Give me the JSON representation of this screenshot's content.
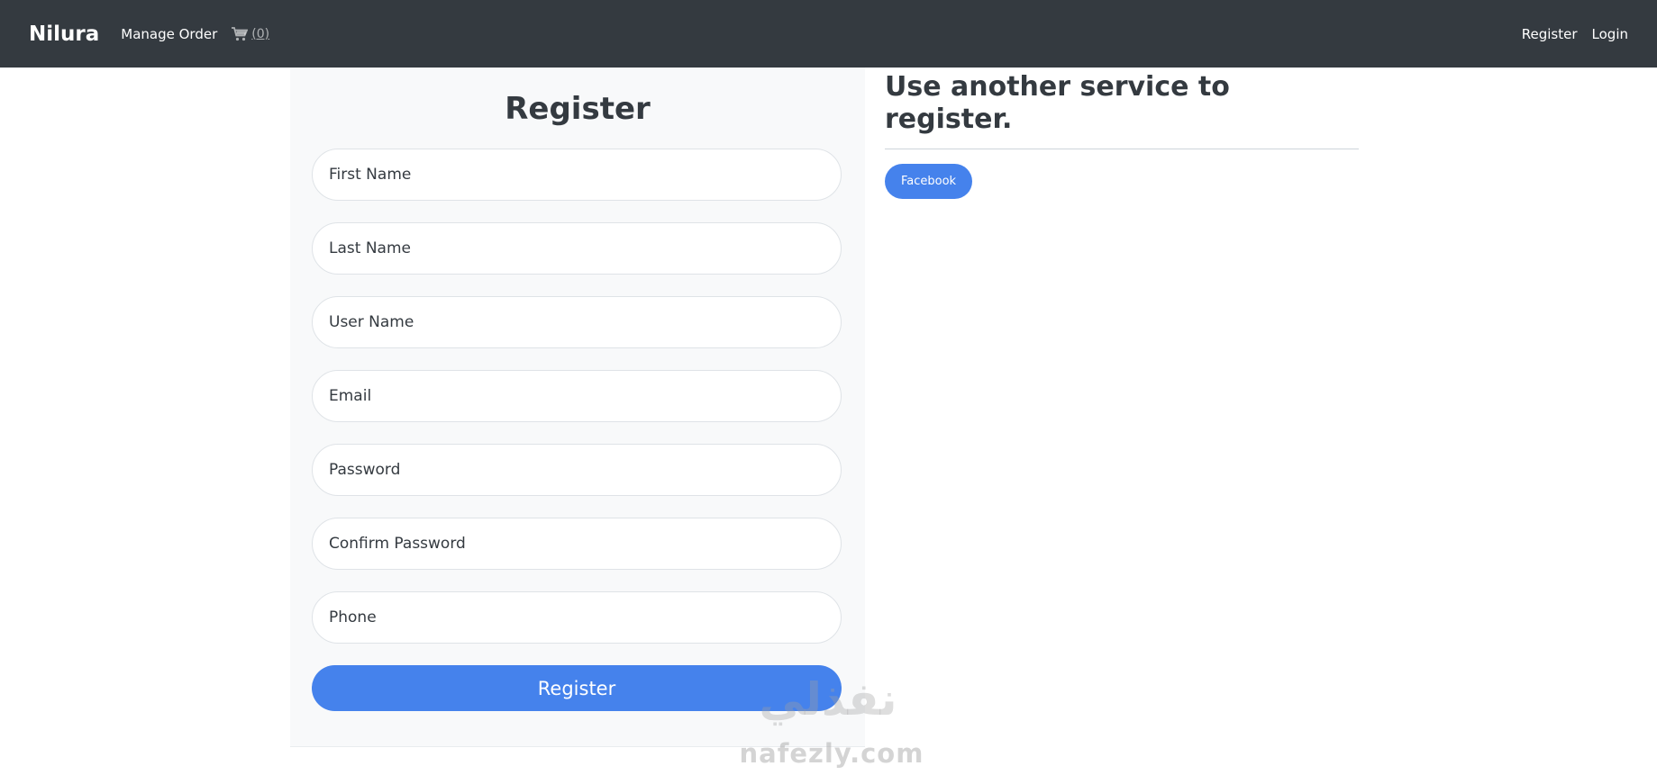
{
  "navbar": {
    "brand": "Nilura",
    "manage_order": "Manage Order",
    "cart_count": "(0)",
    "cart_icon": "cart-icon",
    "register": "Register",
    "login": "Login"
  },
  "register_form": {
    "title": "Register",
    "fields": [
      {
        "name": "first-name",
        "placeholder": "First Name"
      },
      {
        "name": "last-name",
        "placeholder": "Last Name"
      },
      {
        "name": "user-name",
        "placeholder": "User Name"
      },
      {
        "name": "email",
        "placeholder": "Email"
      },
      {
        "name": "password",
        "placeholder": "Password"
      },
      {
        "name": "confirm-password",
        "placeholder": "Confirm Password"
      },
      {
        "name": "phone",
        "placeholder": "Phone"
      }
    ],
    "submit_label": "Register"
  },
  "external_login": {
    "title": "Use another service to register.",
    "facebook_label": "Facebook"
  },
  "watermark": {
    "text": "nafezly.com",
    "arabic": "نفذلي"
  },
  "colors": {
    "navbar": "#343a40",
    "primary": "#4582ec",
    "card_bg": "#f8f9fa"
  }
}
